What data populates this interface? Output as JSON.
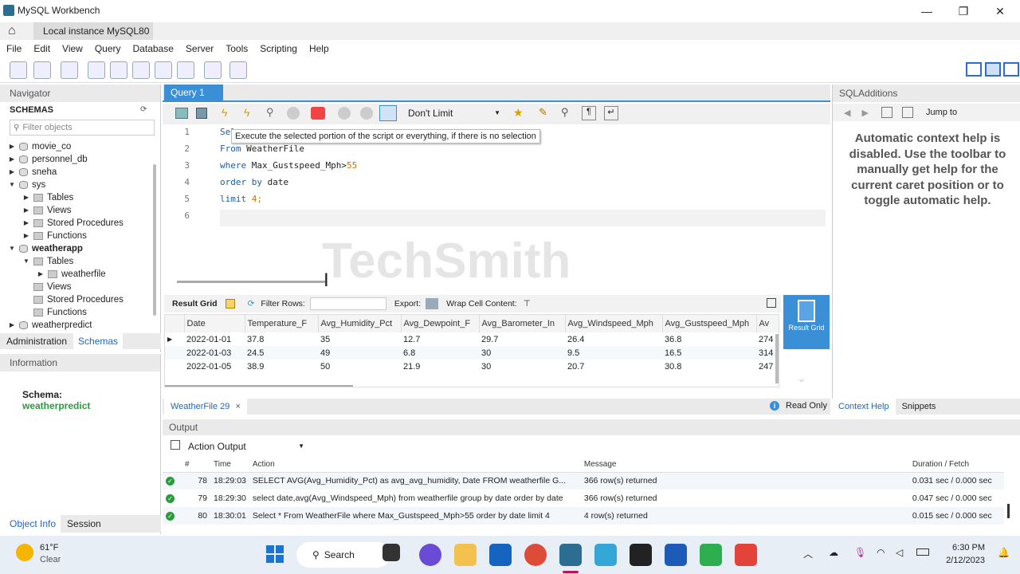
{
  "window": {
    "title": "MySQL Workbench",
    "minimize": "—",
    "restore": "❐",
    "close": "✕"
  },
  "tab": {
    "label": "Local instance MySQL80"
  },
  "menu": [
    "File",
    "Edit",
    "View",
    "Query",
    "Database",
    "Server",
    "Tools",
    "Scripting",
    "Help"
  ],
  "navigator": {
    "title": "Navigator",
    "schemas_label": "SCHEMAS",
    "filter_placeholder": "Filter objects",
    "items": [
      "movie_co",
      "personnel_db",
      "sneha",
      "sys",
      "Tables",
      "Views",
      "Stored Procedures",
      "Functions",
      "weatherapp",
      "Tables",
      "weatherfile",
      "Views",
      "Stored Procedures",
      "Functions",
      "weatherpredict"
    ],
    "tabs": [
      "Administration",
      "Schemas"
    ]
  },
  "information": {
    "title": "Information",
    "schema_label": "Schema:",
    "schema_name": "weatherpredict",
    "tabs": [
      "Object Info",
      "Session"
    ]
  },
  "query": {
    "tab": "Query 1",
    "limit": "Don't Limit",
    "tooltip": "Execute the selected portion of the script or everything, if there is no selection",
    "line_numbers": [
      "1",
      "2",
      "3",
      "4",
      "5",
      "6"
    ],
    "lines": [
      {
        "a": "Sel",
        "b": "",
        "c": ""
      },
      {
        "a": "From",
        "b": " WeatherFile",
        "c": ""
      },
      {
        "a": "where",
        "b": " Max_Gustspeed_Mph>",
        "c": "55"
      },
      {
        "a": "order by",
        "b": " date",
        "c": ""
      },
      {
        "a": "limit",
        "b": " ",
        "c": "4;"
      },
      {
        "a": "",
        "b": "",
        "c": ""
      }
    ]
  },
  "watermark": "TechSmith",
  "result": {
    "label": "Result Grid",
    "filter": "Filter Rows:",
    "export": "Export:",
    "wrap": "Wrap Cell Content:",
    "side_button": "Result Grid",
    "columns": [
      "Date",
      "Temperature_F",
      "Avg_Humidity_Pct",
      "Avg_Dewpoint_F",
      "Avg_Barometer_In",
      "Avg_Windspeed_Mph",
      "Avg_Gustspeed_Mph",
      "Av"
    ],
    "rows": [
      [
        "2022-01-01",
        "37.8",
        "35",
        "12.7",
        "29.7",
        "26.4",
        "36.8",
        "274"
      ],
      [
        "2022-01-03",
        "24.5",
        "49",
        "6.8",
        "30",
        "9.5",
        "16.5",
        "314"
      ],
      [
        "2022-01-05",
        "38.9",
        "50",
        "21.9",
        "30",
        "20.7",
        "30.8",
        "247"
      ]
    ],
    "tab": "WeatherFile 29",
    "close": "×",
    "read_only": "Read Only"
  },
  "output": {
    "title": "Output",
    "selector": "Action Output",
    "columns": [
      "#",
      "Time",
      "Action",
      "Message",
      "Duration / Fetch"
    ],
    "rows": [
      [
        "78",
        "18:29:03",
        "SELECT AVG(Avg_Humidity_Pct) as avg_avg_humidity, Date FROM weatherfile G...",
        "366 row(s) returned",
        "0.031 sec / 0.000 sec"
      ],
      [
        "79",
        "18:29:30",
        "select date,avg(Avg_Windspeed_Mph) from weatherfile group by date order by date",
        "366 row(s) returned",
        "0.047 sec / 0.000 sec"
      ],
      [
        "80",
        "18:30:01",
        "Select * From WeatherFile where Max_Gustspeed_Mph>55 order by date limit 4",
        "4 row(s) returned",
        "0.015 sec / 0.000 sec"
      ]
    ]
  },
  "sql_additions": {
    "title": "SQLAdditions",
    "jump": "Jump to",
    "help": "Automatic context help is disabled. Use the toolbar to manually get help for the current caret position or to toggle automatic help.",
    "tabs": [
      "Context Help",
      "Snippets"
    ]
  },
  "taskbar": {
    "temp": "61°F",
    "weather": "Clear",
    "search": "Search",
    "time": "6:30 PM",
    "date": "2/12/2023"
  }
}
